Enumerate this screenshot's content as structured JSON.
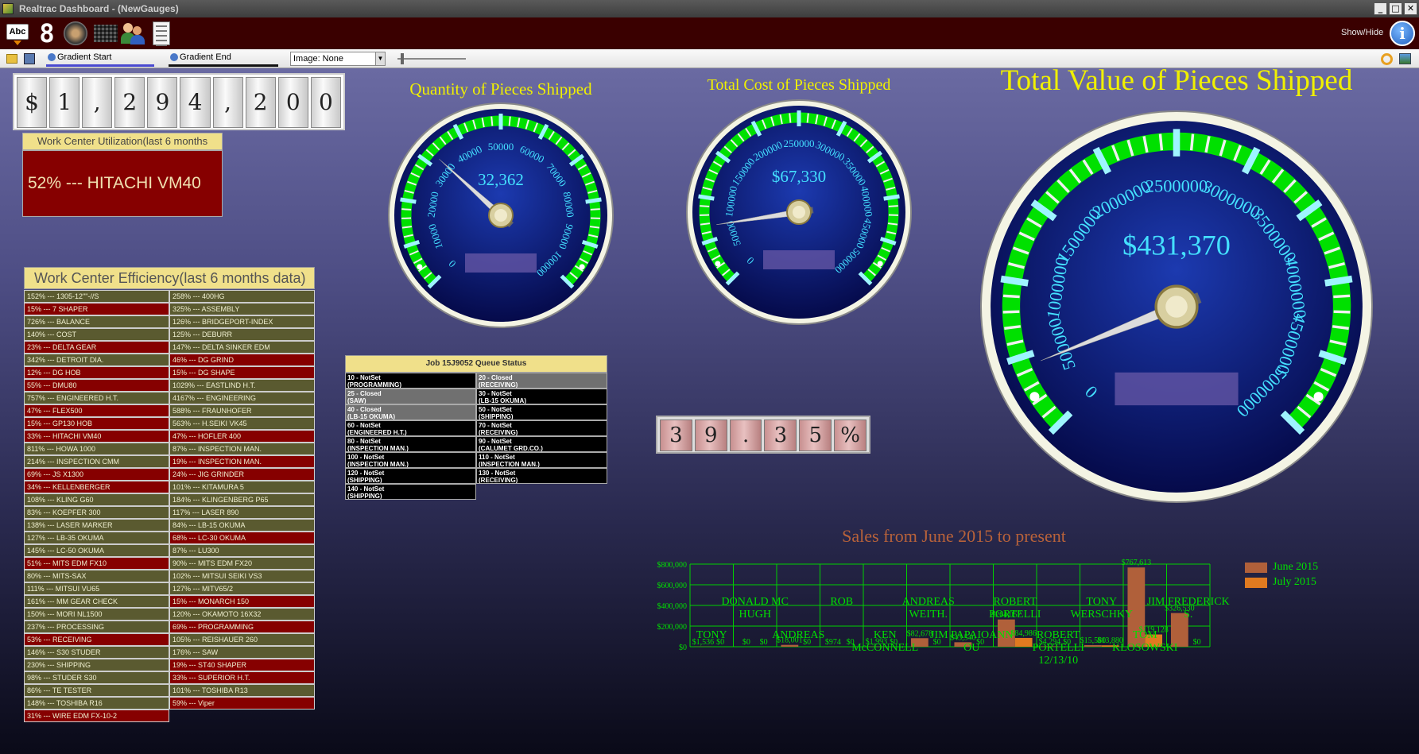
{
  "window": {
    "title": "Realtrac Dashboard - (NewGauges)",
    "buttons": [
      "_",
      "□",
      "✕"
    ]
  },
  "toolbar": {
    "abc_label": "Abc",
    "digit_label": "8",
    "show_hide": "Show/Hide",
    "info_label": "i"
  },
  "toolbar2": {
    "gradient_start": "Gradient Start",
    "gradient_end": "Gradient End",
    "image_label": "Image: None"
  },
  "money_counter": [
    "$",
    "1",
    ",",
    "2",
    "9",
    "4",
    ",",
    "2",
    "0",
    "0"
  ],
  "percent_counter": [
    "3",
    "9",
    ".",
    "3",
    "5",
    "%"
  ],
  "utilization": {
    "header": "Work Center Utilization(last 6 months",
    "value": "52%  --- HITACHI VM40"
  },
  "efficiency": {
    "header": "Work Center Efficiency(last 6 months data)",
    "col_a": [
      {
        "t": "152% --- 1305-12\"\"-//S",
        "s": "ok"
      },
      {
        "t": "15% --- 7 SHAPER",
        "s": "bad"
      },
      {
        "t": "726% --- BALANCE",
        "s": "ok"
      },
      {
        "t": "140% --- COST",
        "s": "ok"
      },
      {
        "t": "23% --- DELTA GEAR",
        "s": "bad"
      },
      {
        "t": "342% --- DETROIT DIA.",
        "s": "ok"
      },
      {
        "t": "12% --- DG HOB",
        "s": "bad"
      },
      {
        "t": "55% --- DMU80",
        "s": "bad"
      },
      {
        "t": "757% --- ENGINEERED H.T.",
        "s": "ok"
      },
      {
        "t": "47% --- FLEX500",
        "s": "bad"
      },
      {
        "t": "15% --- GP130 HOB",
        "s": "bad"
      },
      {
        "t": "33% --- HITACHI VM40",
        "s": "bad"
      },
      {
        "t": "811% --- HOWA 1000",
        "s": "ok"
      },
      {
        "t": "214% --- INSPECTION CMM",
        "s": "ok"
      },
      {
        "t": "69% --- JS X1300",
        "s": "bad"
      },
      {
        "t": "34% --- KELLENBERGER",
        "s": "bad"
      },
      {
        "t": "108% --- KLING G60",
        "s": "ok"
      },
      {
        "t": "83% --- KOEPFER 300",
        "s": "ok"
      },
      {
        "t": "138% --- LASER MARKER",
        "s": "ok"
      },
      {
        "t": "127% --- LB-35    OKUMA",
        "s": "ok"
      },
      {
        "t": "145% --- LC-50    OKUMA",
        "s": "ok"
      },
      {
        "t": "51% --- MITS EDM FX10",
        "s": "bad"
      },
      {
        "t": "80% --- MITS-SAX",
        "s": "ok"
      },
      {
        "t": "111% --- MITSUI VU65",
        "s": "ok"
      },
      {
        "t": "161% --- MM GEAR CHECK",
        "s": "ok"
      },
      {
        "t": "150% --- MORI NL1500",
        "s": "ok"
      },
      {
        "t": "237% --- PROCESSING",
        "s": "ok"
      },
      {
        "t": "53% --- RECEIVING",
        "s": "bad"
      },
      {
        "t": "146% --- S30 STUDER",
        "s": "ok"
      },
      {
        "t": "230% --- SHIPPING",
        "s": "ok"
      },
      {
        "t": "98% --- STUDER S30",
        "s": "ok"
      },
      {
        "t": "86% --- TE TESTER",
        "s": "ok"
      },
      {
        "t": "148% --- TOSHIBA R16",
        "s": "ok"
      },
      {
        "t": "31% --- WIRE EDM FX-10-2",
        "s": "bad"
      }
    ],
    "col_b": [
      {
        "t": "258% --- 400HG",
        "s": "ok"
      },
      {
        "t": "325% --- ASSEMBLY",
        "s": "ok"
      },
      {
        "t": "126% --- BRIDGEPORT-INDEX",
        "s": "ok"
      },
      {
        "t": "125% --- DEBURR",
        "s": "ok"
      },
      {
        "t": "147% --- DELTA SINKER EDM",
        "s": "ok"
      },
      {
        "t": "46% --- DG GRIND",
        "s": "bad"
      },
      {
        "t": "15% --- DG SHAPE",
        "s": "bad"
      },
      {
        "t": "1029% --- EASTLIND H.T.",
        "s": "ok"
      },
      {
        "t": "4167% --- ENGINEERING",
        "s": "ok"
      },
      {
        "t": "588% --- FRAUNHOFER",
        "s": "ok"
      },
      {
        "t": "563% --- H.SEIKI VK45",
        "s": "ok"
      },
      {
        "t": "47% --- HOFLER 400",
        "s": "bad"
      },
      {
        "t": "87% --- INSPECTION MAN.",
        "s": "ok"
      },
      {
        "t": "19% --- INSPECTION MAN.",
        "s": "bad"
      },
      {
        "t": "24% --- JIG GRINDER",
        "s": "bad"
      },
      {
        "t": "101% --- KITAMURA 5",
        "s": "ok"
      },
      {
        "t": "184% --- KLINGENBERG P65",
        "s": "ok"
      },
      {
        "t": "117% --- LASER 890",
        "s": "ok"
      },
      {
        "t": "84% --- LB-15    OKUMA",
        "s": "ok"
      },
      {
        "t": "68% --- LC-30    OKUMA",
        "s": "bad"
      },
      {
        "t": "87% --- LU300",
        "s": "ok"
      },
      {
        "t": "90% --- MITS EDM FX20",
        "s": "ok"
      },
      {
        "t": "102% --- MITSUI SEIKI VS3",
        "s": "ok"
      },
      {
        "t": "127% --- MITV65/2",
        "s": "ok"
      },
      {
        "t": "15% --- MONARCH 150",
        "s": "bad"
      },
      {
        "t": "120% --- OKAMOTO 16X32",
        "s": "ok"
      },
      {
        "t": "69% --- PROGRAMMING",
        "s": "bad"
      },
      {
        "t": "105% --- REISHAUER 260",
        "s": "ok"
      },
      {
        "t": "176% --- SAW",
        "s": "ok"
      },
      {
        "t": "19% --- ST40 SHAPER",
        "s": "bad"
      },
      {
        "t": "33% --- SUPERIOR H.T.",
        "s": "bad"
      },
      {
        "t": "101% --- TOSHIBA R13",
        "s": "ok"
      },
      {
        "t": "59% --- Viper",
        "s": "bad"
      }
    ]
  },
  "queue": {
    "header": "Job 15J9052 Queue Status",
    "cells": [
      {
        "l1": "10 - NotSet",
        "l2": "(PROGRAMMING)",
        "s": "open"
      },
      {
        "l1": "20 - Closed",
        "l2": "(RECEIVING)",
        "s": "closed"
      },
      {
        "l1": "25 - Closed",
        "l2": "(SAW)",
        "s": "closed"
      },
      {
        "l1": "30 - NotSet",
        "l2": "(LB-15    OKUMA)",
        "s": "open"
      },
      {
        "l1": "40 - Closed",
        "l2": "(LB-15    OKUMA)",
        "s": "closed"
      },
      {
        "l1": "50 - NotSet",
        "l2": "(SHIPPING)",
        "s": "open"
      },
      {
        "l1": "60 - NotSet",
        "l2": "(ENGINEERED H.T.)",
        "s": "open"
      },
      {
        "l1": "70 - NotSet",
        "l2": "(RECEIVING)",
        "s": "open"
      },
      {
        "l1": "80 - NotSet",
        "l2": "(INSPECTION  MAN.)",
        "s": "open"
      },
      {
        "l1": "90 - NotSet",
        "l2": "(CALUMET GRD.CO.)",
        "s": "open"
      },
      {
        "l1": "100 - NotSet",
        "l2": "(INSPECTION  MAN.)",
        "s": "open"
      },
      {
        "l1": "110 - NotSet",
        "l2": "(INSPECTION  MAN.)",
        "s": "open"
      },
      {
        "l1": "120 - NotSet",
        "l2": "(SHIPPING)",
        "s": "open"
      },
      {
        "l1": "130 - NotSet",
        "l2": "(RECEIVING)",
        "s": "open"
      },
      {
        "l1": "140 - NotSet",
        "l2": "(SHIPPING)",
        "s": "open"
      }
    ]
  },
  "gauges": [
    {
      "id": "g1",
      "title": "Quantity of Pieces Shipped",
      "readout": "32,362",
      "value": 32362,
      "min": 0,
      "max": 100000,
      "major_step": 10000,
      "labels": [
        "0",
        "10000",
        "20000",
        "30000",
        "40000",
        "50000",
        "60000",
        "70000",
        "80000",
        "90000",
        "100000"
      ]
    },
    {
      "id": "g2",
      "title": "Total Cost of Pieces Shipped",
      "readout": "$67,330",
      "value": 67330,
      "min": 0,
      "max": 500000,
      "major_step": 50000,
      "labels": [
        "0",
        "50000",
        "100000",
        "150000",
        "200000",
        "250000",
        "300000",
        "350000",
        "400000",
        "450000",
        "500000"
      ]
    },
    {
      "id": "g3",
      "title": "Total Value of Pieces Shipped",
      "readout": "$431,370",
      "value": 431370,
      "min": 0,
      "max": 5000000,
      "major_step": 500000,
      "labels": [
        "0",
        "500000",
        "1000000",
        "1500000",
        "2000000",
        "2500000",
        "3000000",
        "3500000",
        "4000000",
        "4500000",
        "5000000"
      ]
    }
  ],
  "colors": {
    "gauge_face": "#0a1a8a",
    "gauge_ring": "#00e000",
    "gauge_label": "#44e0ff",
    "june": "#b0603a",
    "july": "#e07a20"
  },
  "sales": {
    "title": "Sales from June 2015 to present",
    "legend": [
      "June 2015",
      "July 2015"
    ],
    "y_ticks": [
      "$0",
      "$200,000",
      "$400,000",
      "$600,000",
      "$800,000"
    ],
    "categories_upper": [
      {
        "label": "DONALD MC HUGH"
      },
      {
        "label": "ROB"
      },
      {
        "label": "ANDREAS WEITH."
      },
      {
        "label": "ROBERT PORTELLI"
      },
      {
        "label": "TONY WERSCHKY"
      },
      {
        "label": "JIM FREDERICK S."
      }
    ],
    "categories_lower": [
      {
        "label": "TONY"
      },
      {
        "label": "ANDREAS"
      },
      {
        "label": "KEN McCONNELL"
      },
      {
        "label": "JIM PAPAIOANN OU"
      },
      {
        "label": "ROBERT PORTELLI 12/13/10"
      },
      {
        "label": "TOM KLOSOWSKI"
      }
    ]
  },
  "chart_data": {
    "type": "bar",
    "title": "Sales from June 2015 to present",
    "categories": [
      "TONY",
      "DONALD MC HUGH",
      "ANDREAS",
      "ROB",
      "KEN McCONNELL",
      "ANDREAS WEITH.",
      "JIM PAPAIOANN OU",
      "ROBERT PORTELLI",
      "ROBERT PORTELLI 12/13/10",
      "TONY WERSCHKY",
      "TOM KLOSOWSKI",
      "JIM FREDERICK S."
    ],
    "series": [
      {
        "name": "June 2015",
        "values": [
          1536,
          0,
          18001,
          974,
          1993,
          82678,
          43540,
          264057,
          4294,
          15580,
          767613,
          326530
        ],
        "labels": [
          "$1,536",
          "$0",
          "$18,001",
          "$974",
          "$1,993",
          "$82,678",
          "$43,540",
          "$264,057",
          "$4,294",
          "$15,580",
          "$767,613",
          "$326,530"
        ]
      },
      {
        "name": "July 2015",
        "values": [
          0,
          0,
          0,
          0,
          0,
          0,
          0,
          84986,
          0,
          13880,
          119128,
          0
        ],
        "labels": [
          "$0",
          "$0",
          "$0",
          "$0",
          "$0",
          "$0",
          "$0",
          "$84,986",
          "$0",
          "$13,880",
          "$119,128",
          "$0"
        ]
      }
    ],
    "ylim": [
      0,
      800000
    ],
    "legend_position": "right",
    "grid": true
  }
}
